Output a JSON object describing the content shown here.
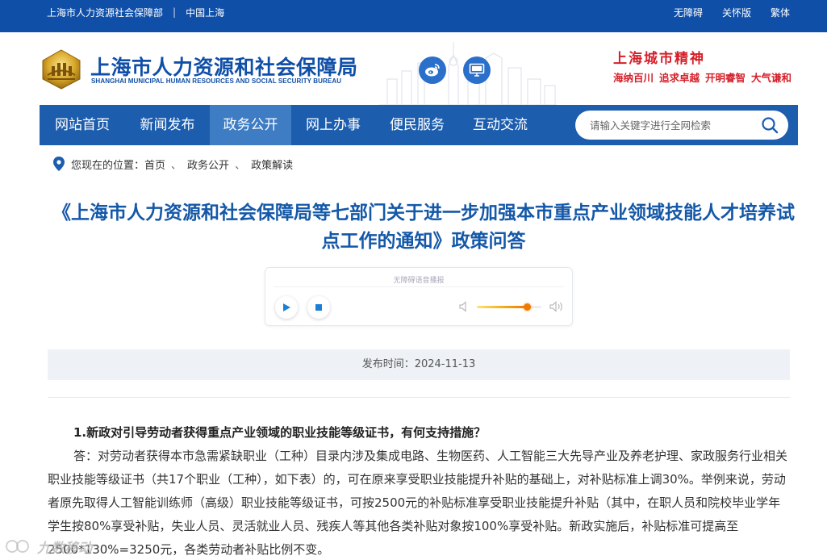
{
  "topbar": {
    "org_link": "上海市人力资源社会保障部",
    "region_link": "中国上海",
    "accessibility": "无障碍",
    "elderly_mode": "关怀版",
    "traditional": "繁体"
  },
  "header": {
    "site_name": "上海市人力资源和社会保障局",
    "site_name_en": "SHANGHAI MUNICIPAL HUMAN RESOURCES AND SOCIAL SECURITY BUREAU",
    "logo_text": "上海",
    "spirit_title": "上海城市精神",
    "spirit_words": [
      "海纳百川",
      "追求卓越",
      "开明睿智",
      "大气谦和"
    ],
    "social_icons": [
      "weibo-icon",
      "monitor-icon"
    ]
  },
  "nav": {
    "items": [
      {
        "label": "网站首页",
        "active": false
      },
      {
        "label": "新闻发布",
        "active": false
      },
      {
        "label": "政务公开",
        "active": true
      },
      {
        "label": "网上办事",
        "active": false
      },
      {
        "label": "便民服务",
        "active": false
      },
      {
        "label": "互动交流",
        "active": false
      }
    ],
    "search_placeholder": "请输入关键字进行全网检索"
  },
  "breadcrumb": {
    "prefix": "您现在的位置：",
    "items": [
      "首页",
      "政务公开",
      "政策解读"
    ],
    "separator": "、"
  },
  "article": {
    "title": "《上海市人力资源和社会保障局等七部门关于进一步加强本市重点产业领域技能人才培养试点工作的通知》政策问答",
    "player_label": "无障碍语音播报",
    "volume": 0.78,
    "publish_label": "发布时间：2024-11-13",
    "question": "1.新政对引导劳动者获得重点产业领域的职业技能等级证书，有何支持措施？",
    "answer": "答：对劳动者获得本市急需紧缺职业（工种）目录内涉及集成电路、生物医药、人工智能三大先导产业及养老护理、家政服务行业相关职业技能等级证书（共17个职业（工种），如下表）的，可在原来享受职业技能提升补贴的基础上，对补贴标准上调30%。举例来说，劳动者原先取得人工智能训练师（高级）职业技能等级证书，可按2500元的补贴标准享受职业技能提升补贴（其中，在职人员和院校毕业学年学生按80%享受补贴，失业人员、灵活就业人员、残疾人等其他各类补贴对象按100%享受补贴。新政实施后，补贴标准可提高至2500*130%=3250元，各类劳动者补贴比例不变。"
  },
  "watermark": {
    "text": "九数移动"
  },
  "colors": {
    "brand_blue": "#0f4fa8",
    "nav_blue": "#1c5dae",
    "nav_active": "#3e7cc3",
    "title_blue": "#1458a8",
    "spirit_red": "#d4202a",
    "volume_orange": "#f07a00"
  }
}
